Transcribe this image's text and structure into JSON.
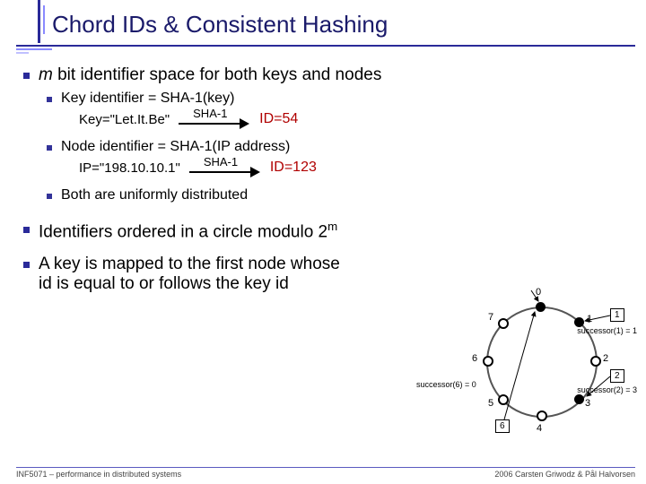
{
  "title": "Chord IDs & Consistent Hashing",
  "bullets": {
    "b1": {
      "prefix_m": "m",
      "text": " bit identifier space for both keys and nodes"
    },
    "b1a": "Key identifier = SHA-1(key)",
    "ex1": {
      "left": "Key=\"Let.It.Be\"",
      "arrow": "SHA-1",
      "right": "ID=54"
    },
    "b1b": "Node identifier = SHA-1(IP address)",
    "ex2": {
      "left": "IP=\"198.10.10.1\"",
      "arrow": "SHA-1",
      "right": "ID=123"
    },
    "b1c": "Both are uniformly distributed",
    "b2": {
      "text": "Identifiers ordered in a circle modulo 2",
      "sup": "m"
    },
    "b3": "A key is mapped to the first node whose id is equal to or follows the key id"
  },
  "diagram": {
    "node_labels": [
      "0",
      "1",
      "2",
      "3",
      "4",
      "5",
      "6",
      "7"
    ],
    "boxes": {
      "k1": "1",
      "k2": "2",
      "k6": "6"
    },
    "succ": {
      "s1": "successor(1) = 1",
      "s2": "successor(2) = 3",
      "s6": "successor(6) = 0"
    }
  },
  "footer": {
    "left": "INF5071 – performance in distributed systems",
    "right": "2006 Carsten Griwodz & Pål Halvorsen"
  }
}
